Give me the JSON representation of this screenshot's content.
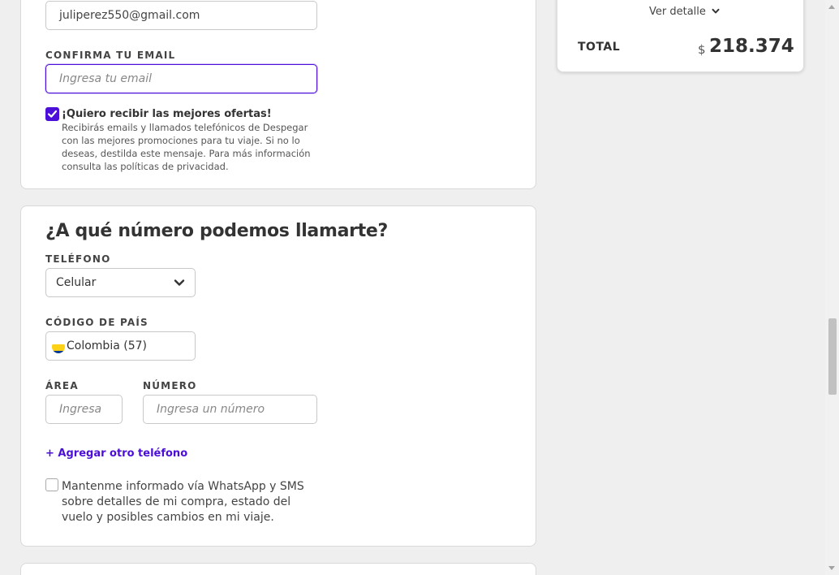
{
  "email_section": {
    "email_value": "juliperez550@gmail.com",
    "confirm_label": "CONFIRMA TU EMAIL",
    "confirm_placeholder": "Ingresa tu email",
    "offers_title": "¡Quiero recibir las mejores ofertas!",
    "offers_desc": "Recibirás emails y llamados telefónicos de Despegar con las mejores promociones para tu viaje. Si no lo deseas, destilda este mensaje. Para más información consulta las políticas de privacidad.",
    "offers_checked": true
  },
  "phone_section": {
    "title": "¿A qué número podemos llamarte?",
    "phone_type_label": "TELÉFONO",
    "phone_type_value": "Celular",
    "country_code_label": "CÓDIGO DE PAÍS",
    "country_code_value": "Colombia (57)",
    "area_label": "ÁREA",
    "area_placeholder": "Ingresa",
    "number_label": "NÚMERO",
    "number_placeholder": "Ingresa un número",
    "add_phone_link": "+ Agregar otro teléfono",
    "whatsapp_text": "Mantenme informado vía WhatsApp y SMS sobre detalles de mi compra, estado del vuelo y posibles cambios en mi viaje.",
    "whatsapp_checked": false
  },
  "summary": {
    "detail_link": "Ver detalle",
    "total_label": "TOTAL",
    "currency_symbol": "$",
    "total_value": "218.374"
  },
  "colors": {
    "accent": "#4b0fd9",
    "background": "#efefef"
  }
}
